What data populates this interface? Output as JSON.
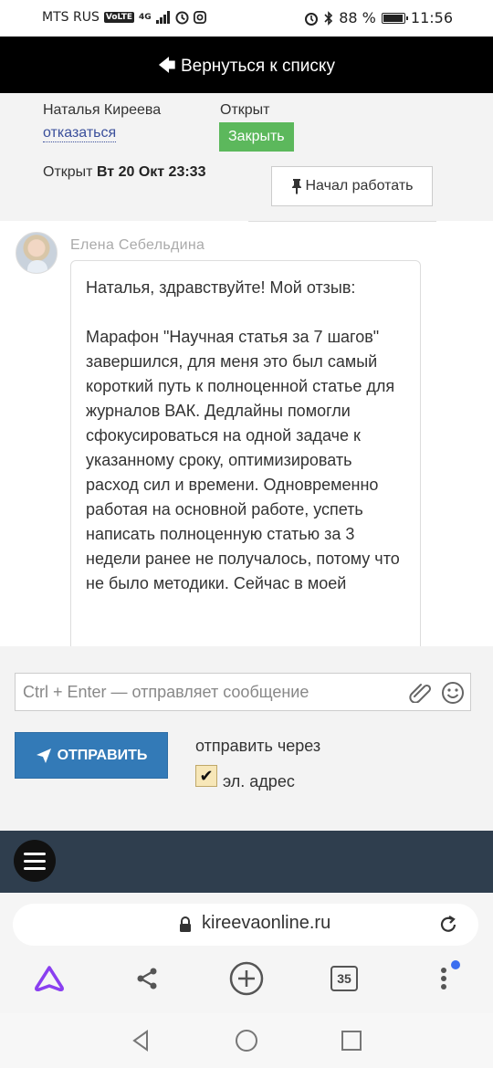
{
  "status_bar": {
    "carrier": "MTS RUS",
    "volte": "VoLTE",
    "network": "4G",
    "battery": "88 %",
    "time": "11:56"
  },
  "nav": {
    "back_label": "Вернуться к списку"
  },
  "ticket": {
    "owner": "Наталья Киреева",
    "refuse_label": "отказаться",
    "status": "Открыт",
    "close_label": "Закрыть",
    "opened_prefix": "Открыт",
    "opened_date": "Вт 20 Окт 23:33",
    "start_work_label": "Начал работать"
  },
  "message": {
    "author": "Елена Себельдина",
    "greeting": "Наталья, здравствуйте! Мой отзыв:",
    "body": "Марафон \"Научная статья за 7 шагов\" завершился, для меня это был самый короткий  путь к полноценной статье для журналов ВАК. Дедлайны помогли сфокусироваться на одной задаче к указанному сроку, оптимизировать расход сил и времени. Одновременно работая на основной работе, успеть написать полноценную статью за 3 недели ранее не получалось, потому что не было методики. Сейчас в моей"
  },
  "composer": {
    "placeholder": "Ctrl + Enter — отправляет сообщение",
    "send_label": "ОТПРАВИТЬ",
    "send_via_label": "отправить через",
    "email_label": "эл. адрес",
    "email_checked": true
  },
  "browser": {
    "url": "kireevaonline.ru",
    "tabs_count": "35"
  },
  "icons": {
    "accent_blue": "#337ab7",
    "close_green": "#5cb85c"
  }
}
